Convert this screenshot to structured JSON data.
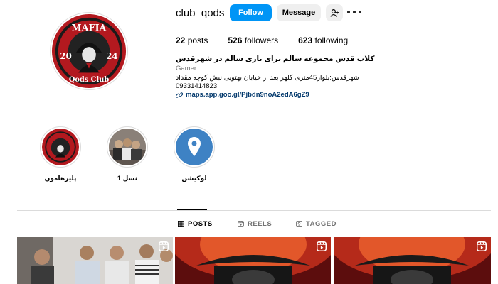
{
  "profile": {
    "username": "club_qods",
    "follow_label": "Follow",
    "message_label": "Message",
    "avatar_text": {
      "top": "MAFIA",
      "year_left": "20",
      "year_right": "24",
      "bottom": "Qods Club"
    }
  },
  "stats": {
    "posts_count": "22",
    "posts_label": "posts",
    "followers_count": "526",
    "followers_label": "followers",
    "following_count": "623",
    "following_label": "following"
  },
  "bio": {
    "title": "کلاب قدس مجموعه سالم برای بازی سالم در شهرقدس",
    "category": "Gamer",
    "address": "شهرقدس:بلوار45متری کلهر بعد از خیابان بهتویی نبش کوچه مقداد",
    "phone": "09331414823",
    "link": "maps.app.goo.gl/Pjbdn9noA2edA6gZ9"
  },
  "highlights": [
    {
      "label": "پلیرهامون",
      "icon": "mafia-logo"
    },
    {
      "label": "نسل 1",
      "icon": "group-photo"
    },
    {
      "label": "لوکیشن",
      "icon": "location-pin-icon"
    }
  ],
  "tabs": [
    {
      "label": "POSTS",
      "icon": "grid-icon",
      "active": true
    },
    {
      "label": "REELS",
      "icon": "reels-icon",
      "active": false
    },
    {
      "label": "TAGGED",
      "icon": "tag-icon",
      "active": false
    }
  ],
  "colors": {
    "accent": "#0095f6",
    "link": "#00376b",
    "logo_red": "#b3191f",
    "pin_blue": "#3e82c4"
  }
}
